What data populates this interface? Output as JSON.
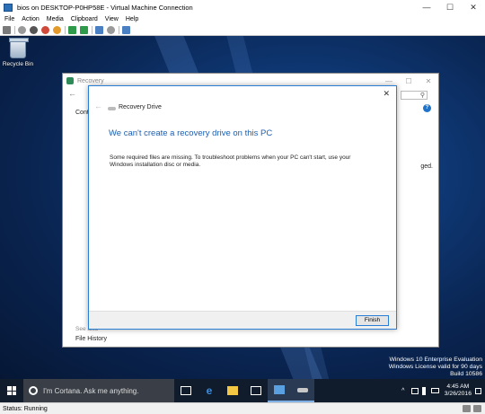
{
  "host_window": {
    "title": "bios on DESKTOP-P0HP58E - Virtual Machine Connection",
    "controls": {
      "minimize": "—",
      "maximize": "☐",
      "close": "✕"
    }
  },
  "menu": {
    "items": [
      "File",
      "Action",
      "Media",
      "Clipboard",
      "View",
      "Help"
    ]
  },
  "toolbar": {
    "buttons": [
      {
        "icon": "ctrl-alt-del-icon",
        "color": "#7a7a7a"
      },
      {
        "icon": "start-icon",
        "color": "#9a9a9a"
      },
      {
        "icon": "turn-off-icon",
        "color": "#555555"
      },
      {
        "icon": "shutdown-icon",
        "color": "#d04a3a"
      },
      {
        "icon": "save-state-icon",
        "color": "#e49a2a"
      },
      {
        "icon": "pause-icon",
        "color": "#2e9a4a"
      },
      {
        "icon": "resume-icon",
        "color": "#2e9a4a"
      },
      {
        "icon": "checkpoint-icon",
        "color": "#4a7fc1"
      },
      {
        "icon": "revert-icon",
        "color": "#9a9a9a"
      },
      {
        "icon": "enhanced-session-icon",
        "color": "#4a7fc1"
      }
    ]
  },
  "desktop": {
    "recycle_bin_label": "Recycle Bin",
    "watermark": {
      "line1": "Windows 10 Enterprise Evaluation",
      "line2": "Windows License valid for 90 days",
      "line3": "Build 10586"
    }
  },
  "control_panel": {
    "title": "Recovery",
    "back": "←",
    "search_glyph": "⚲",
    "help": "?",
    "partial_text_left": "Contr",
    "partial_text_right": "ged.",
    "see_also": "See also",
    "file_history": "File History",
    "controls": {
      "minimize": "—",
      "maximize": "☐",
      "close": "✕"
    }
  },
  "dialog": {
    "back": "←",
    "close": "✕",
    "app_title": "Recovery Drive",
    "heading": "We can't create a recovery drive on this PC",
    "body": "Some required files are missing. To troubleshoot problems when your PC can't start, use your Windows installation disc or media.",
    "finish_label": "Finish"
  },
  "taskbar": {
    "cortana_placeholder": "I'm Cortana. Ask me anything.",
    "apps": [
      {
        "name": "task-view-icon",
        "color": "#ffffff"
      },
      {
        "name": "edge-icon",
        "color": "#3b8ee0"
      },
      {
        "name": "file-explorer-icon",
        "color": "#f3c743"
      },
      {
        "name": "store-icon",
        "color": "#ffffff"
      },
      {
        "name": "control-panel-icon",
        "color": "#5aa0e0"
      },
      {
        "name": "recovery-drive-icon",
        "color": "#c8c8c8"
      }
    ],
    "tray": {
      "expand": "^",
      "time": "4:45 AM",
      "date": "3/26/2016"
    }
  },
  "status": {
    "text": "Status: Running"
  }
}
